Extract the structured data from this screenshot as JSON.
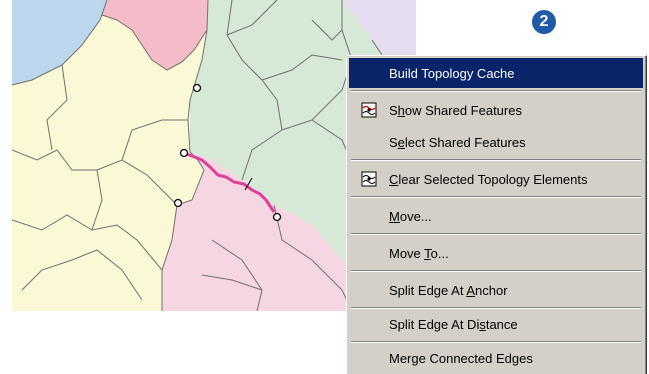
{
  "callout": {
    "number": "2"
  },
  "colors": {
    "menu_bg": "#d4d0c8",
    "highlight": "#0a246a",
    "callout": "#1e5aa8",
    "edge_selected": "#e0409a",
    "region_blue": "#bcd6ee",
    "region_red": "#f3bcc8",
    "region_green": "#d6e8d6",
    "region_yellow": "#fbf8d6",
    "region_pink": "#f6d6e2",
    "region_lavender": "#e6dcef"
  },
  "context_menu": {
    "items": [
      {
        "label": "Build Topology Cache",
        "pre": "",
        "mn": "",
        "post": "Build Topology Cache",
        "highlighted": true,
        "icon": ""
      },
      {
        "label": "Show Shared Features",
        "pre": "S",
        "mn": "h",
        "post": "ow Shared Features",
        "highlighted": false,
        "icon": "shared-features-icon"
      },
      {
        "label": "Select Shared Features",
        "pre": "S",
        "mn": "e",
        "post": "lect Shared Features",
        "highlighted": false,
        "icon": ""
      },
      {
        "label": "Clear Selected Topology Elements",
        "pre": "",
        "mn": "C",
        "post": "lear Selected Topology Elements",
        "highlighted": false,
        "icon": "clear-topology-icon"
      },
      {
        "label": "Move...",
        "pre": "",
        "mn": "M",
        "post": "ove...",
        "highlighted": false,
        "icon": ""
      },
      {
        "label": "Move To...",
        "pre": "Move ",
        "mn": "T",
        "post": "o...",
        "highlighted": false,
        "icon": ""
      },
      {
        "label": "Split Edge At Anchor",
        "pre": "Split Edge At ",
        "mn": "A",
        "post": "nchor",
        "highlighted": false,
        "icon": ""
      },
      {
        "label": "Split Edge At Distance",
        "pre": "Split Edge At Di",
        "mn": "s",
        "post": "tance",
        "highlighted": false,
        "icon": ""
      },
      {
        "label": "Merge Connected Edges",
        "pre": "Mer",
        "mn": "g",
        "post": "e Connected Edges",
        "highlighted": false,
        "icon": ""
      }
    ]
  }
}
